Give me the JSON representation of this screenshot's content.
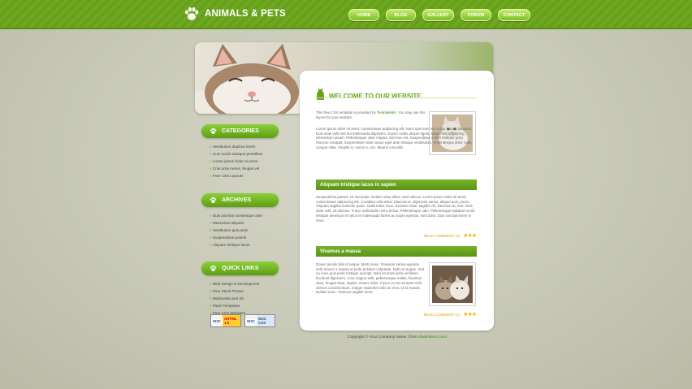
{
  "site": {
    "title": "ANIMALS & PETS"
  },
  "nav": [
    {
      "label": "HOME"
    },
    {
      "label": "BLOG"
    },
    {
      "label": "GALLERY"
    },
    {
      "label": "FORUM"
    },
    {
      "label": "CONTACT"
    }
  ],
  "sidebar": {
    "categories": {
      "title": "CATEGORIES",
      "items": [
        "Vestibulum dapibus lorem",
        "Cum sociis natoque penatibus",
        "Lorem ipsum dolor sit amet",
        "Cras urna metus, feugiat vel",
        "Free CSS Layouts"
      ]
    },
    "archives": {
      "title": "ARCHIVES",
      "items": [
        "Duis pulvinar scelerisque ante",
        "Maecenas aliquam",
        "Vestibulum quis pede",
        "Suspendisse potenti",
        "Aliquam tristique lacus"
      ]
    },
    "quicklinks": {
      "title": "QUICK LINKS",
      "items": [
        "Web Design & Development",
        "Free Stock Photos",
        "Multimedia and 3D",
        "Flash Templates",
        "Free CSS Websites"
      ]
    },
    "badges": [
      "XHTML 1.0",
      "W3C CSS"
    ]
  },
  "main": {
    "welcome_title": "WELCOME TO OUR WEBSITE",
    "intro_prefix": "This free CSS template is provided by ",
    "intro_link": "TemplateMo",
    "intro_suffix": ". You may use this layout for your website.",
    "lorem1": "Lorem ipsum dolor sit amet, consectetuer adipiscing elit. Nunc quis sem nec tellus blandit tincidunt. Duis vitae velit sed dui malesuada dignissim. Donec mollis aliquet ligula. Maecenas adipiscing elementum ipsum. Pellentesque vitae magna. Sed nec est. Suspendisse a nibh tristique justo rhoncus volutpat. Suspendisse vitae neque eget ante tristique vestibulum. Pellentesque dolor nulla, congue vitae, fringilla in, varius a, orci. Mauris convallis.",
    "post1": {
      "title": "Aliquam tristique lacus in sapien",
      "body": "Suspendisse potenti. Ut sed pede. Nullam vitae tellus. Sed ultrices. Lorem ipsum dolor sit amet, consectetuer adipiscing elit. Curabitur velit tellus, placerat et, dignissim varius, aliquet quis, purus. Aliquam sagittis molestie quam. Nulla tellus risus, tincidunt vitae, sagittis vel, interdum at, erat. Duis vitae velit. Ut ultricies. Fusce sollicitudin nisl a lectus. Pellentesque odio. Pellentesque habitant morbi tristique senectus et netus et malesuada fames ac turpis egestas. Sed dolor. Duis suscipit lorem in risus.",
      "read": "READ COMMENT (3)"
    },
    "post2": {
      "title": "Vivamus a massa",
      "body": "Donec iaculis felis id neque. Morbi nunc. Praesent varius egestas velit. Donec a massa ut pede pulvinar vulputate. Nulla et augue. Sed eu nunc quis pede tristique suscipit. Nam sit amet justo vel libero tincidunt dignissim. Cras magna velit, pellentesque mattis, faucibus vitae, feugiat vitae, sapien. Donec dolor. Fusce et orci sit amet velit ultrices condimentum. Integer imperdiet odio ac eros. Ut id massa. Nullam nunc. Vivamus sagittis tortor.",
      "read": "READ COMMENT (1)"
    }
  },
  "footer": {
    "copyright": "Copyright © Your Company Name",
    "sep": " | from ",
    "link": "dowindemo.com"
  }
}
